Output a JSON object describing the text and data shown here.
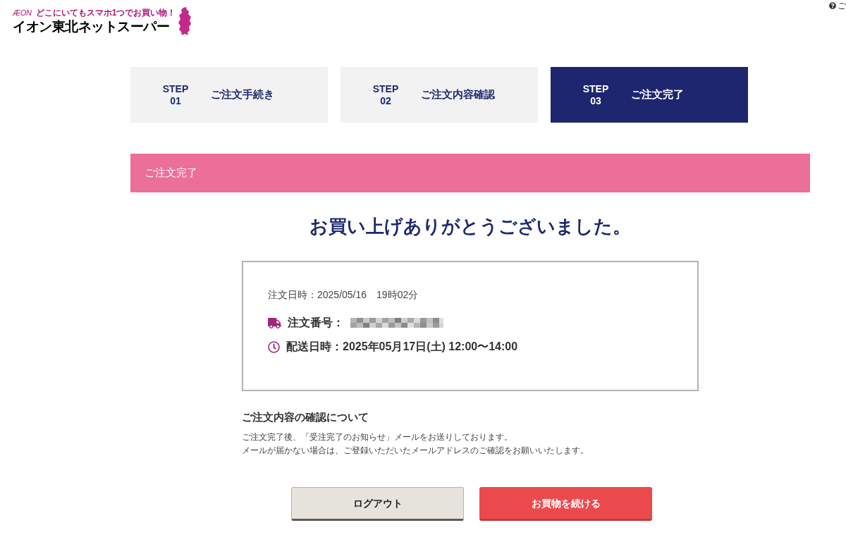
{
  "header": {
    "brand": "ÆON",
    "tagline": "どこにいてもスマホ1つでお買い物！",
    "site_name": "イオン東北ネットスーパー",
    "help_link": "ご"
  },
  "steps": [
    {
      "label": "STEP",
      "number": "01",
      "title": "ご注文手続き",
      "selected": false
    },
    {
      "label": "STEP",
      "number": "02",
      "title": "ご注文内容確認",
      "selected": false
    },
    {
      "label": "STEP",
      "number": "03",
      "title": "ご注文完了",
      "selected": true
    }
  ],
  "section_bar": {
    "title": "ご注文完了"
  },
  "thank_you_message": "お買い上げありがとうございました。",
  "order_summary": {
    "order_date": "注文日時：2025/05/16　19時02分",
    "details": [
      {
        "kind": "order_number",
        "text": "注文番号："
      },
      {
        "kind": "delivery_time",
        "text": "配送日時：2025年05月17日(土) 12:00〜14:00"
      }
    ]
  },
  "confirmation_note": {
    "heading": "ご注文内容の確認について",
    "lines": [
      "ご注文完了後、「受注完了のお知らせ」メールをお送りしております。",
      "メールが届かない場合は、ご登録いただいたメールアドレスのご確認をお願いいたします。"
    ]
  },
  "buttons": [
    {
      "kind": "secondary",
      "label": "ログアウト"
    },
    {
      "kind": "primary",
      "label": "お買物を続ける"
    }
  ]
}
